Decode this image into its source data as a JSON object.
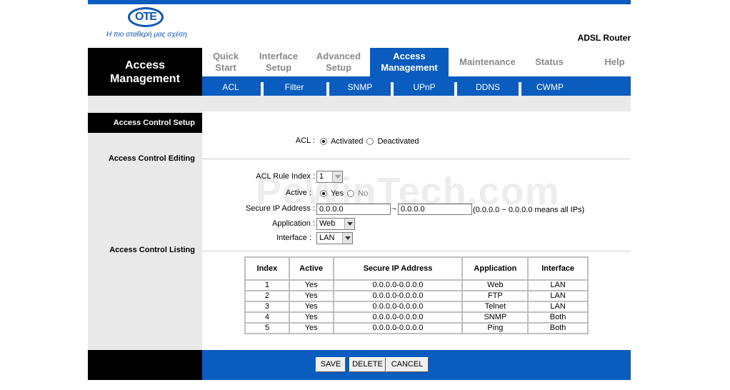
{
  "header": {
    "logo_text": "OTE",
    "slogan": "Η πιο σταθερή μας σχέση",
    "product": "ADSL Router"
  },
  "section_title": "Access Management",
  "main_nav": [
    {
      "label": "Quick Start"
    },
    {
      "label": "Interface Setup"
    },
    {
      "label": "Advanced Setup"
    },
    {
      "label": "Access Management",
      "active": true
    },
    {
      "label": "Maintenance"
    },
    {
      "label": "Status"
    },
    {
      "label": "Help"
    }
  ],
  "sub_nav": [
    "ACL",
    "Filter",
    "SNMP",
    "UPnP",
    "DDNS",
    "CWMP"
  ],
  "sidebar": {
    "setup": "Access Control Setup",
    "editing": "Access Control Editing",
    "listing": "Access Control Listing"
  },
  "acl": {
    "label": "ACL :",
    "activated": "Activated",
    "deactivated": "Deactivated",
    "selected": "Activated"
  },
  "editing": {
    "rule_index_label": "ACL Rule Index :",
    "rule_index_value": "1",
    "active_label": "Active :",
    "active_yes": "Yes",
    "active_no": "No",
    "secure_ip_label": "Secure IP Address :",
    "ip_from": "0.0.0.0",
    "ip_tilde": "~",
    "ip_to": "0.0.0.0",
    "ip_hint": "(0.0.0.0 ~ 0.0.0.0 means all IPs)",
    "application_label": "Application :",
    "application_value": "Web",
    "interface_label": "Interface :",
    "interface_value": "LAN"
  },
  "table": {
    "headers": [
      "Index",
      "Active",
      "Secure IP Address",
      "Application",
      "Interface"
    ],
    "rows": [
      [
        "1",
        "Yes",
        "0.0.0.0-0.0.0.0",
        "Web",
        "LAN"
      ],
      [
        "2",
        "Yes",
        "0.0.0.0-0.0.0.0",
        "FTP",
        "LAN"
      ],
      [
        "3",
        "Yes",
        "0.0.0.0-0.0.0.0",
        "Telnet",
        "LAN"
      ],
      [
        "4",
        "Yes",
        "0.0.0.0-0.0.0.0",
        "SNMP",
        "Both"
      ],
      [
        "5",
        "Yes",
        "0.0.0.0-0.0.0.0",
        "Ping",
        "Both"
      ]
    ]
  },
  "buttons": {
    "save": "SAVE",
    "delete": "DELETE",
    "cancel": "CANCEL"
  },
  "watermark": "PcWinTech.com",
  "colors": {
    "brand_blue": "#0a5cbf",
    "panel_grey": "#e9e9e9"
  }
}
